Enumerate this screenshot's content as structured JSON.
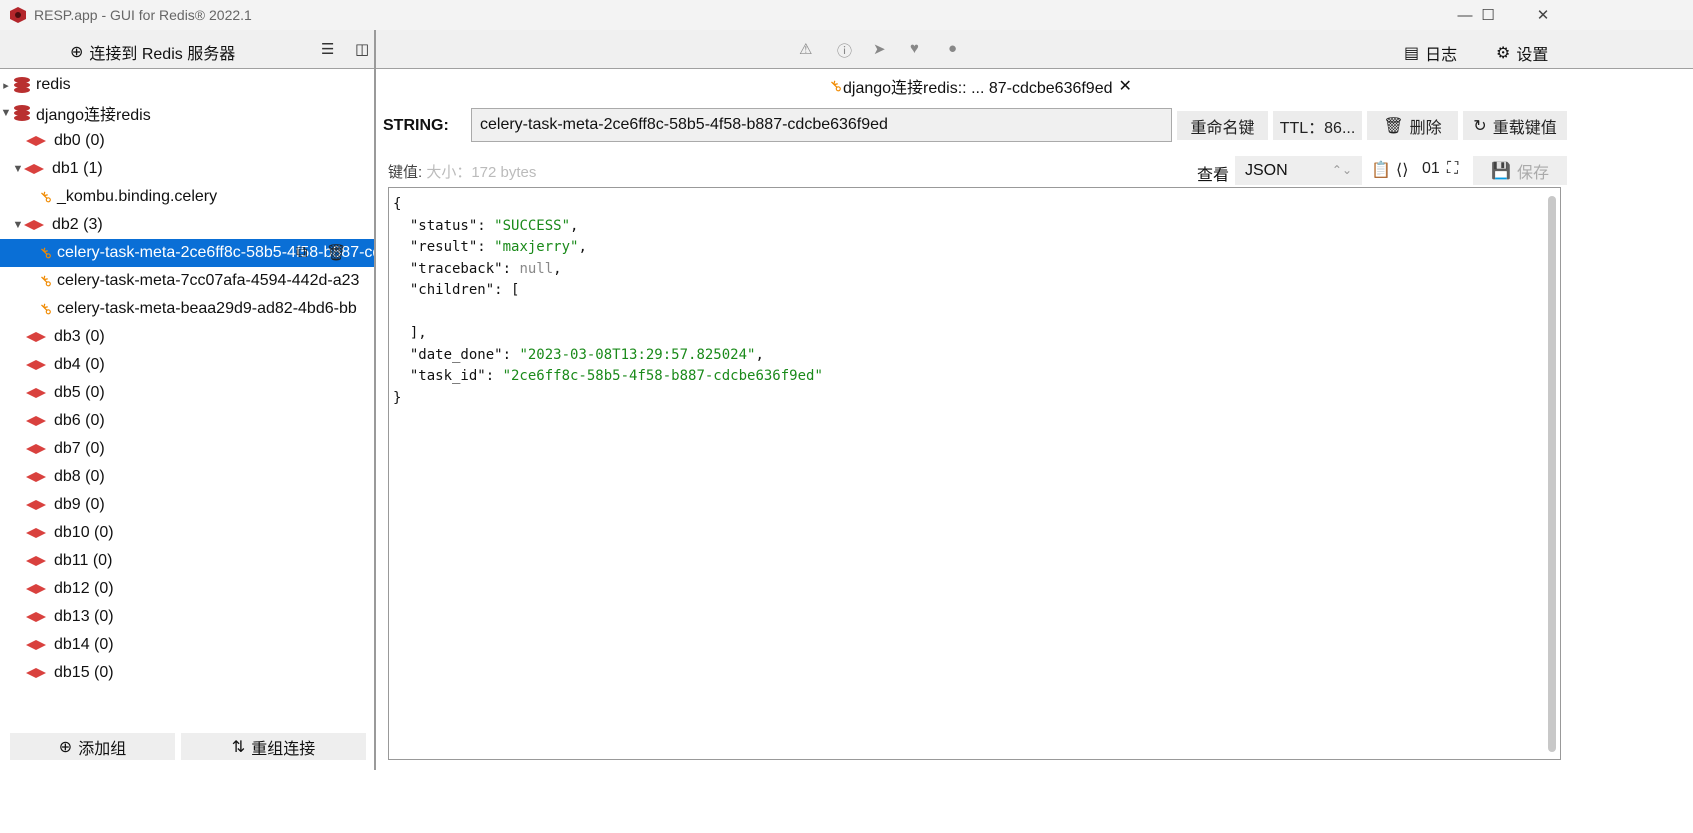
{
  "window": {
    "title": "RESP.app - GUI for Redis® 2022.1",
    "minimize": "—",
    "maximize": "☐",
    "close": "✕"
  },
  "toolbar": {
    "connect_label": "连接到 Redis 服务器",
    "log_label": "日志",
    "settings_label": "设置"
  },
  "tree": {
    "connections": [
      {
        "name": "redis"
      },
      {
        "name": "django连接redis"
      }
    ],
    "dbs": [
      "db0  (0)",
      "db1  (1)",
      "db2  (3)",
      "db3  (0)",
      "db4  (0)",
      "db5  (0)",
      "db6  (0)",
      "db7  (0)",
      "db8  (0)",
      "db9  (0)",
      "db10  (0)",
      "db11  (0)",
      "db12  (0)",
      "db13  (0)",
      "db14  (0)",
      "db15  (0)"
    ],
    "db1_keys": [
      "_kombu.binding.celery"
    ],
    "db2_keys": [
      "celery-task-meta-2ce6ff8c-58b5-4f58-b887-cdcbe636f9ed",
      "celery-task-meta-7cc07afa-4594-442d-a23",
      "celery-task-meta-beaa29d9-ad82-4bd6-bb"
    ]
  },
  "bottom": {
    "add_group": "添加组",
    "reorder": "重组连接"
  },
  "tab": {
    "label": "django连接redis:: ... 87-cdcbe636f9ed"
  },
  "key": {
    "type": "STRING:",
    "name": "celery-task-meta-2ce6ff8c-58b5-4f58-b887-cdcbe636f9ed",
    "rename": "重命名键",
    "ttl": "TTL：86...",
    "delete": "删除",
    "reload": "重载键值"
  },
  "value": {
    "label": "键值:",
    "size": "大小：172 bytes",
    "view_label": "查看",
    "view_mode": "JSON",
    "save": "保存"
  },
  "json_lines": [
    {
      "t": "{"
    },
    {
      "k": "  \"status\": ",
      "v": "\"SUCCESS\"",
      "c": "s",
      "e": ","
    },
    {
      "k": "  \"result\": ",
      "v": "\"maxjerry\"",
      "c": "s",
      "e": ","
    },
    {
      "k": "  \"traceback\": ",
      "v": "null",
      "c": "n",
      "e": ","
    },
    {
      "t": "  \"children\": ["
    },
    {
      "t": ""
    },
    {
      "t": "  ],"
    },
    {
      "k": "  \"date_done\": ",
      "v": "\"2023-03-08T13:29:57.825024\"",
      "c": "s",
      "e": ","
    },
    {
      "k": "  \"task_id\": ",
      "v": "\"2ce6ff8c-58b5-4f58-b887-cdcbe636f9ed\"",
      "c": "s",
      "e": ""
    },
    {
      "t": "}"
    }
  ],
  "colors": {
    "selection": "#0a6fd6",
    "db_icon": "#d9413e",
    "key_icon": "#f08a00",
    "json_string": "#1a8a1a"
  }
}
